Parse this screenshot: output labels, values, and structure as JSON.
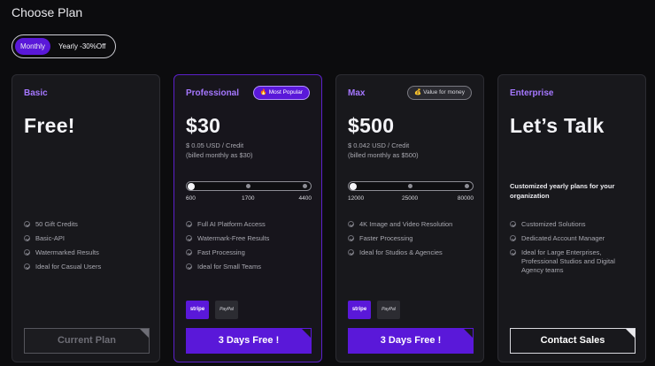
{
  "page": {
    "title": "Choose Plan"
  },
  "billing_toggle": {
    "monthly": "Monthly",
    "yearly": "Yearly -30%Off",
    "selected": "Monthly"
  },
  "plans": [
    {
      "name": "Basic",
      "price": "Free!",
      "features": [
        "50 Gift Credits",
        "Basic-API",
        "Watermarked Results",
        "Ideal for Casual Users"
      ],
      "cta": "Current Plan"
    },
    {
      "name": "Professional",
      "badge": "🔥 Most Popular",
      "price": "$30",
      "price_note_1": "$ 0.05 USD / Credit",
      "price_note_2": "(billed monthly as $30)",
      "slider_ticks": [
        "600",
        "1700",
        "4400"
      ],
      "slider_value_index": 0,
      "features": [
        "Full AI Platform Access",
        "Watermark-Free Results",
        "Fast Processing",
        "Ideal for Small Teams"
      ],
      "payment": [
        "stripe",
        "PayPal"
      ],
      "cta": "3 Days Free !"
    },
    {
      "name": "Max",
      "badge": "💰 Value for money",
      "price": "$500",
      "price_note_1": "$ 0.042 USD / Credit",
      "price_note_2": "(billed monthly as $500)",
      "slider_ticks": [
        "12000",
        "25000",
        "80000"
      ],
      "slider_value_index": 0,
      "features": [
        "4K Image and Video Resolution",
        "Faster Processing",
        "Ideal for Studios & Agencies"
      ],
      "payment": [
        "stripe",
        "PayPal"
      ],
      "cta": "3 Days Free !"
    },
    {
      "name": "Enterprise",
      "price": "Let’s Talk",
      "description": "Customized yearly plans for your organization",
      "features": [
        "Customized Solutions",
        "Dedicated Account Manager",
        "Ideal for Large Enterprises, Professional Studios and Digital Agency teams"
      ],
      "cta": "Contact Sales"
    }
  ],
  "colors": {
    "accent": "#5a18d9",
    "plan_name": "#a577ff",
    "background": "#0c0c0e",
    "card": "#18181c"
  }
}
